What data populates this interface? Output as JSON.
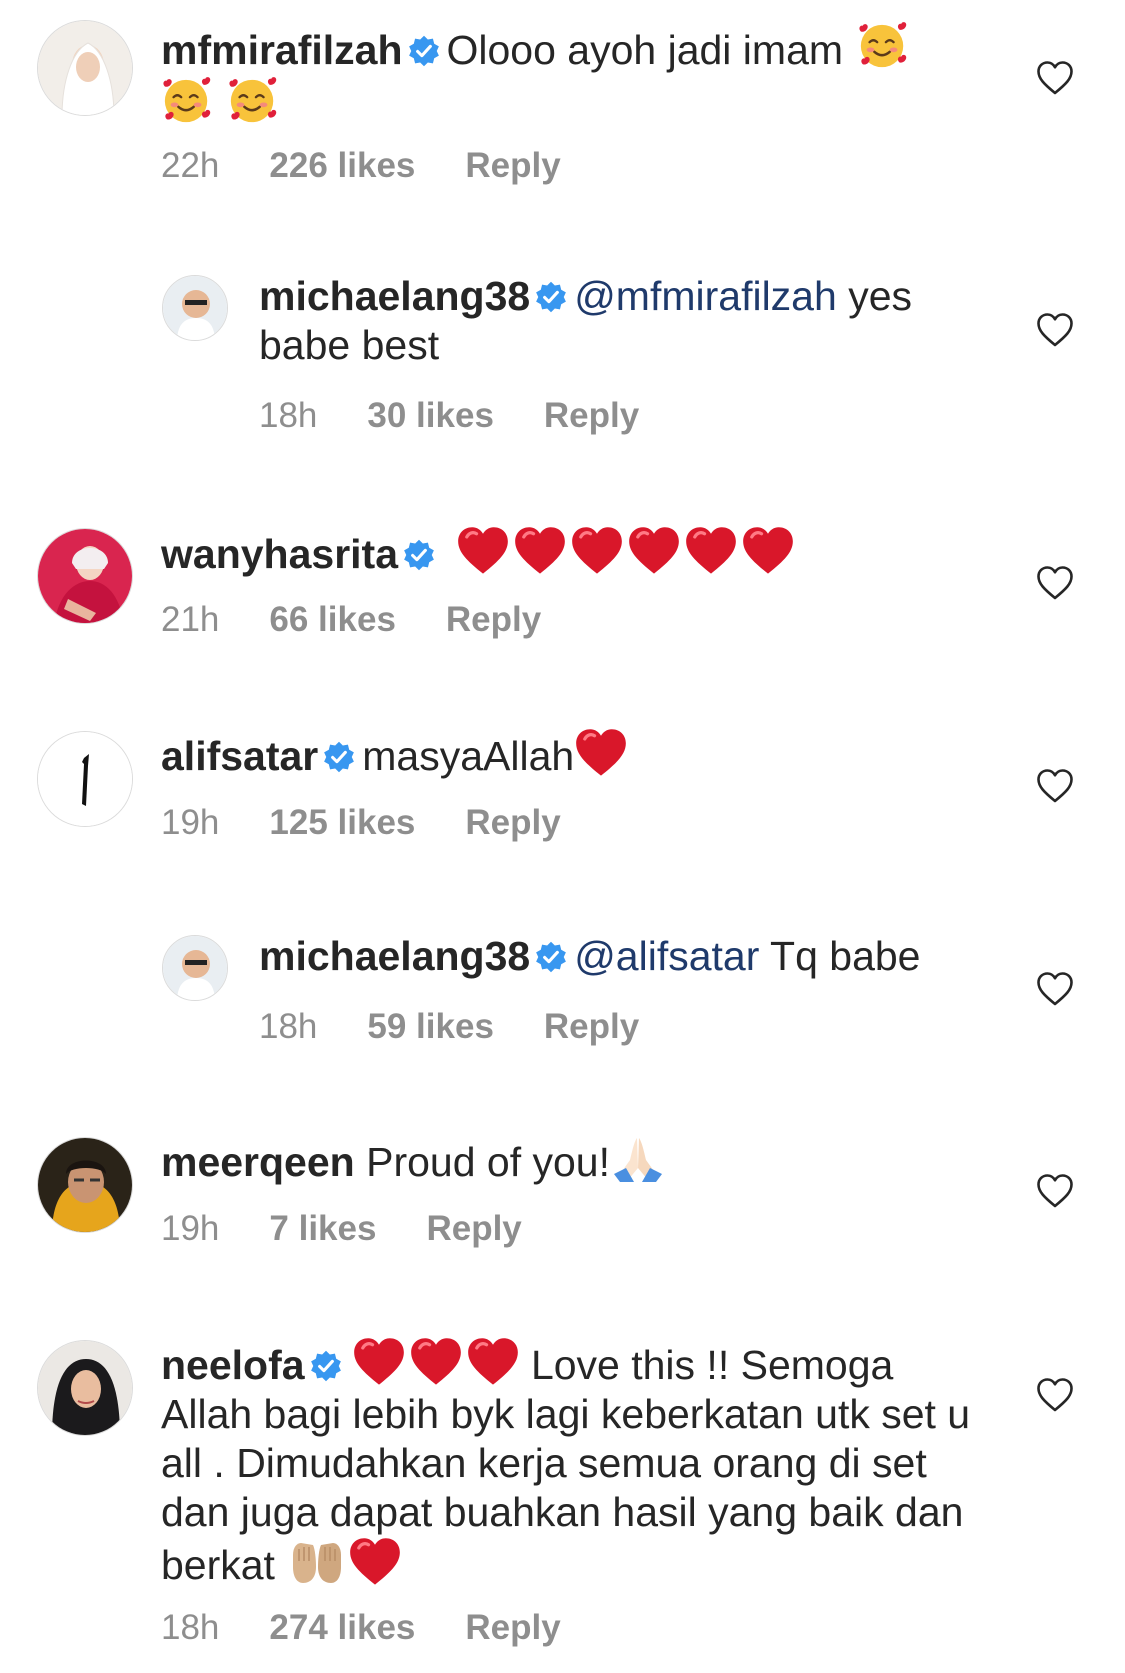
{
  "comments": [
    {
      "username": "mfmirafilzah",
      "text": "Olooo ayoh jadi imam",
      "time": "22h",
      "likes": "226 likes",
      "reply": "Reply"
    },
    {
      "username": "michaelang38",
      "mention": "@mfmirafilzah",
      "text": " yes babe best",
      "time": "18h",
      "likes": "30 likes",
      "reply": "Reply"
    },
    {
      "username": "wanyhasrita",
      "text": "",
      "time": "21h",
      "likes": "66 likes",
      "reply": "Reply"
    },
    {
      "username": "alifsatar",
      "text": "masyaAllah",
      "time": "19h",
      "likes": "125 likes",
      "reply": "Reply"
    },
    {
      "username": "michaelang38",
      "mention": "@alifsatar",
      "text": " Tq babe",
      "time": "18h",
      "likes": "59 likes",
      "reply": "Reply"
    },
    {
      "username": "meerqeen",
      "text": "Proud of you!",
      "time": "19h",
      "likes": "7 likes",
      "reply": "Reply"
    },
    {
      "username": "neelofa",
      "text": " Love this !! Semoga Allah bagi lebih byk lagi keberkatan utk set u all . Dimudahkan kerja semua orang di set dan juga dapat buahkan hasil yang baik dan berkat",
      "time": "18h",
      "likes": "274 likes",
      "reply": "Reply"
    }
  ],
  "colors": {
    "verified": "#3897f0",
    "meta": "#8e8e8e",
    "heart_emoji": "#d9172a",
    "mention": "#1f3a6b"
  },
  "icons": [
    "verified-badge-icon",
    "like-heart-icon",
    "smiling-hearts-emoji",
    "red-heart-emoji",
    "folded-hands-emoji",
    "open-hands-emoji"
  ]
}
